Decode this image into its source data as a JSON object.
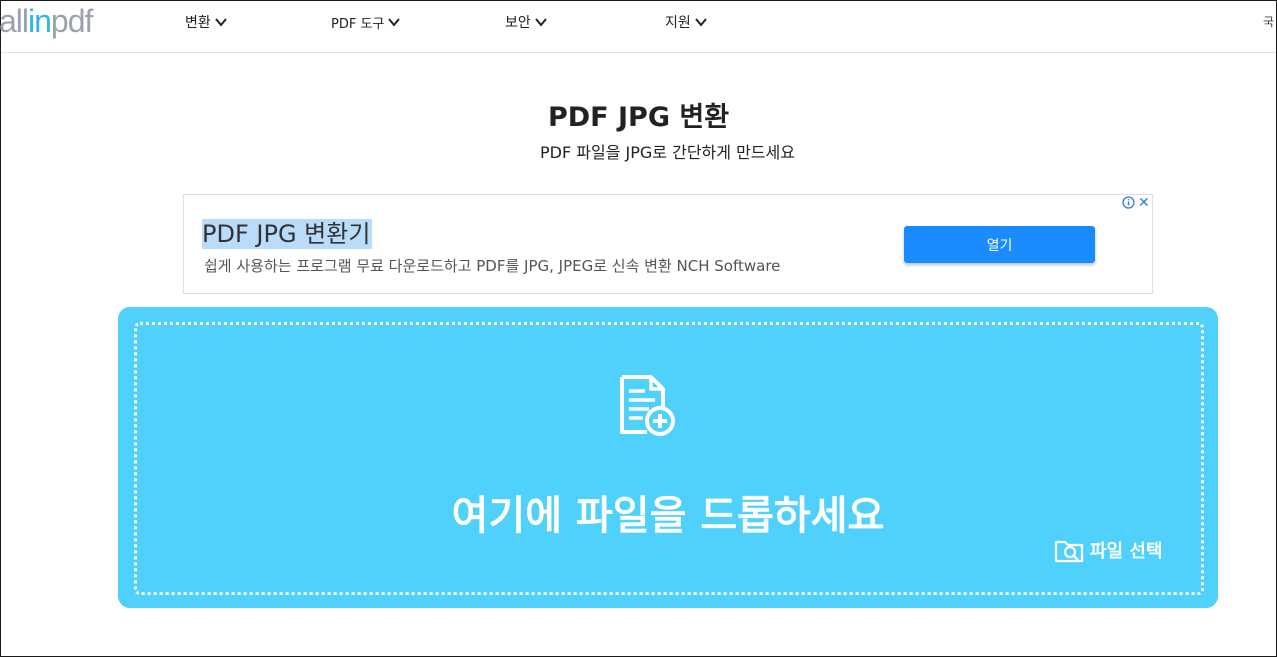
{
  "header": {
    "logo": {
      "part1": "all",
      "part2": "in",
      "part3": "pdf"
    },
    "nav": [
      {
        "label": "변환"
      },
      {
        "label": "PDF 도구"
      },
      {
        "label": "보안"
      },
      {
        "label": "지원"
      }
    ],
    "edge_mark": "국"
  },
  "main": {
    "title": "PDF JPG 변환",
    "subtitle": "PDF 파일을 JPG로 간단하게 만드세요"
  },
  "ad": {
    "title": "PDF JPG 변환기",
    "description": "쉽게 사용하는 프로그램 무료 다운로드하고 PDF를 JPG, JPEG로 신속 변환 NCH Software",
    "open_label": "열기",
    "close_label": "✕"
  },
  "dropzone": {
    "text": "여기에 파일을 드롭하세요",
    "choose_label": "파일 선택"
  },
  "colors": {
    "accent": "#4fd1fb",
    "logo_highlight": "#2eb8e6",
    "ad_button": "#1a8cff"
  },
  "icons": {
    "nav_chevron": "chevron-down-icon",
    "ad_info": "info-icon",
    "ad_close": "close-icon",
    "upload": "file-add-icon",
    "choose": "folder-search-icon"
  }
}
